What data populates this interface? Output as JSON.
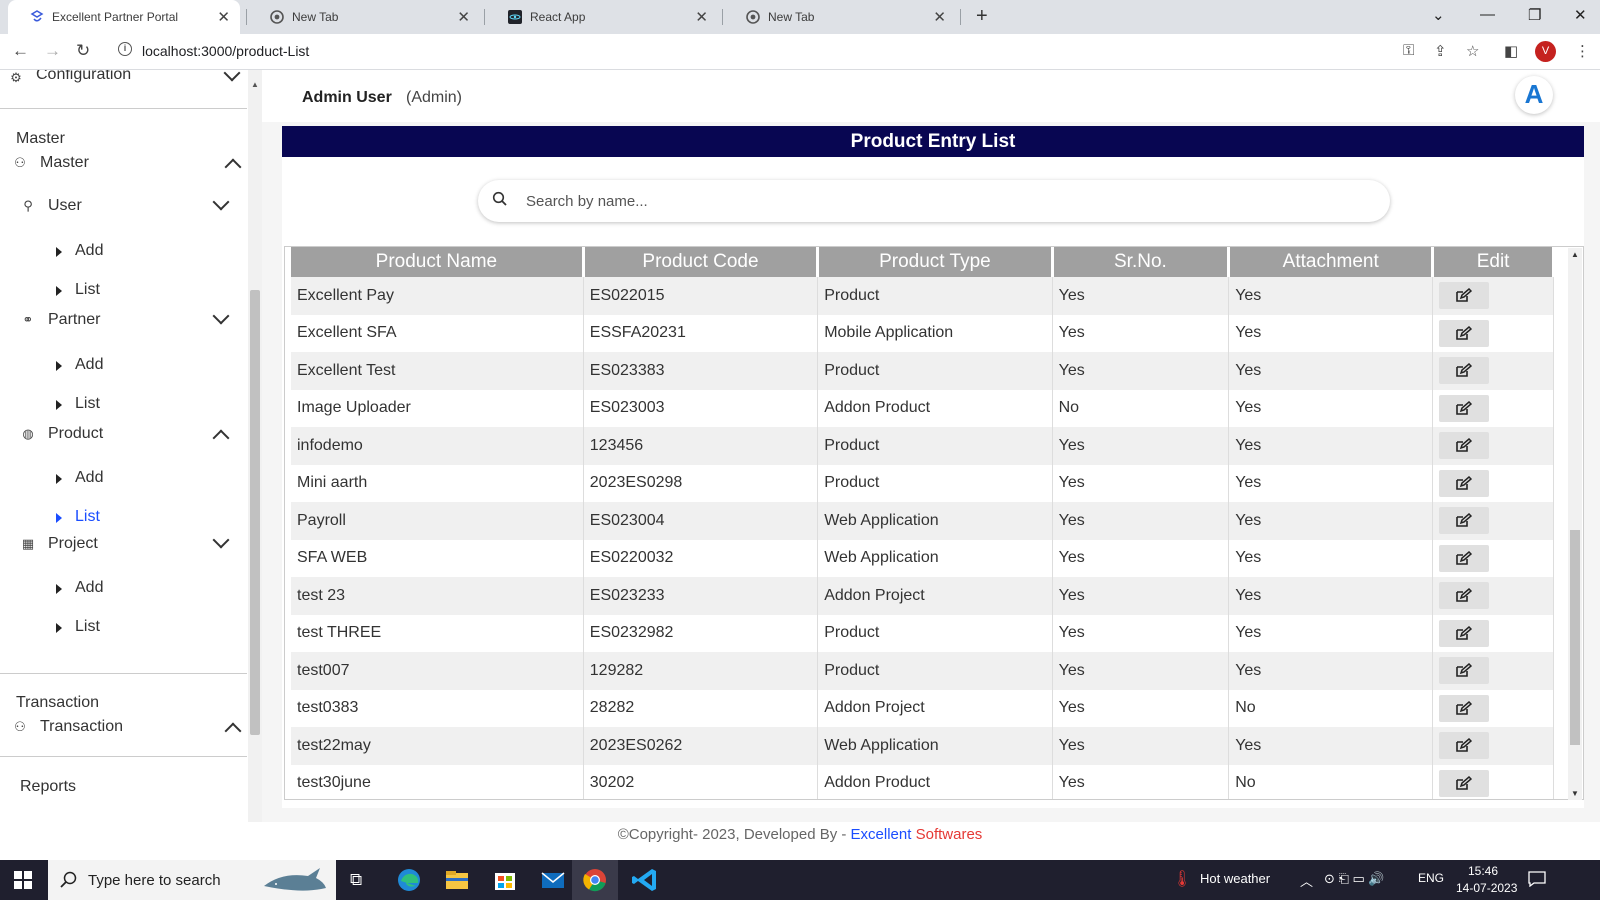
{
  "browser": {
    "tabs": [
      {
        "title": "Excellent Partner Portal",
        "active": true
      },
      {
        "title": "New Tab",
        "active": false
      },
      {
        "title": "React App",
        "active": false
      },
      {
        "title": "New Tab",
        "active": false
      }
    ],
    "url": "localhost:3000/product-List",
    "profile_initial": "V"
  },
  "sidebar": {
    "top_cut_label": "Configuration",
    "sections": [
      {
        "heading": "Master",
        "group": "Master"
      },
      {
        "heading": "Transaction",
        "group": "Transaction"
      }
    ],
    "items": [
      {
        "label": "User",
        "sub": [
          "Add",
          "List"
        ]
      },
      {
        "label": "Partner",
        "sub": [
          "Add",
          "List"
        ]
      },
      {
        "label": "Product",
        "sub": [
          "Add",
          "List"
        ]
      },
      {
        "label": "Project",
        "sub": [
          "Add",
          "List"
        ]
      }
    ],
    "reports_label": "Reports"
  },
  "header": {
    "user_name": "Admin User",
    "user_role": "(Admin)",
    "avatar_letter": "A"
  },
  "page": {
    "title": "Product Entry List",
    "search_placeholder": "Search by name..."
  },
  "table": {
    "columns": [
      "Product Name",
      "Product Code",
      "Product Type",
      "Sr.No.",
      "Attachment",
      "Edit"
    ],
    "rows": [
      [
        "Excellent Pay",
        "ES022015",
        "Product",
        "Yes",
        "Yes"
      ],
      [
        "Excellent SFA",
        "ESSFA20231",
        "Mobile Application",
        "Yes",
        "Yes"
      ],
      [
        "Excellent Test",
        "ES023383",
        "Product",
        "Yes",
        "Yes"
      ],
      [
        "Image Uploader",
        "ES023003",
        "Addon Product",
        "No",
        "Yes"
      ],
      [
        "infodemo",
        "123456",
        "Product",
        "Yes",
        "Yes"
      ],
      [
        "Mini aarth",
        "2023ES0298",
        "Product",
        "Yes",
        "Yes"
      ],
      [
        "Payroll",
        "ES023004",
        "Web Application",
        "Yes",
        "Yes"
      ],
      [
        "SFA WEB",
        "ES0220032",
        "Web Application",
        "Yes",
        "Yes"
      ],
      [
        "test 23",
        "ES023233",
        "Addon Project",
        "Yes",
        "Yes"
      ],
      [
        "test THREE",
        "ES0232982",
        "Product",
        "Yes",
        "Yes"
      ],
      [
        "test007",
        "129282",
        "Product",
        "Yes",
        "Yes"
      ],
      [
        "test0383",
        "28282",
        "Addon Project",
        "Yes",
        "No"
      ],
      [
        "test22may",
        "2023ES0262",
        "Web Application",
        "Yes",
        "Yes"
      ],
      [
        "test30june",
        "30202",
        "Addon Product",
        "Yes",
        "No"
      ]
    ]
  },
  "footer": {
    "prefix": "©Copyright- 2023, Developed By - ",
    "brand_blue": "Excellent",
    "brand_red": "Softwares"
  },
  "taskbar": {
    "search_placeholder": "Type here to search",
    "weather": "Hot weather",
    "language": "ENG",
    "time": "15:46",
    "date": "14-07-2023"
  },
  "colors": {
    "title_bar": "#080652",
    "table_header": "#a0a0a0",
    "active_link": "#1a4dff",
    "footer_brand_red": "#e53935"
  }
}
